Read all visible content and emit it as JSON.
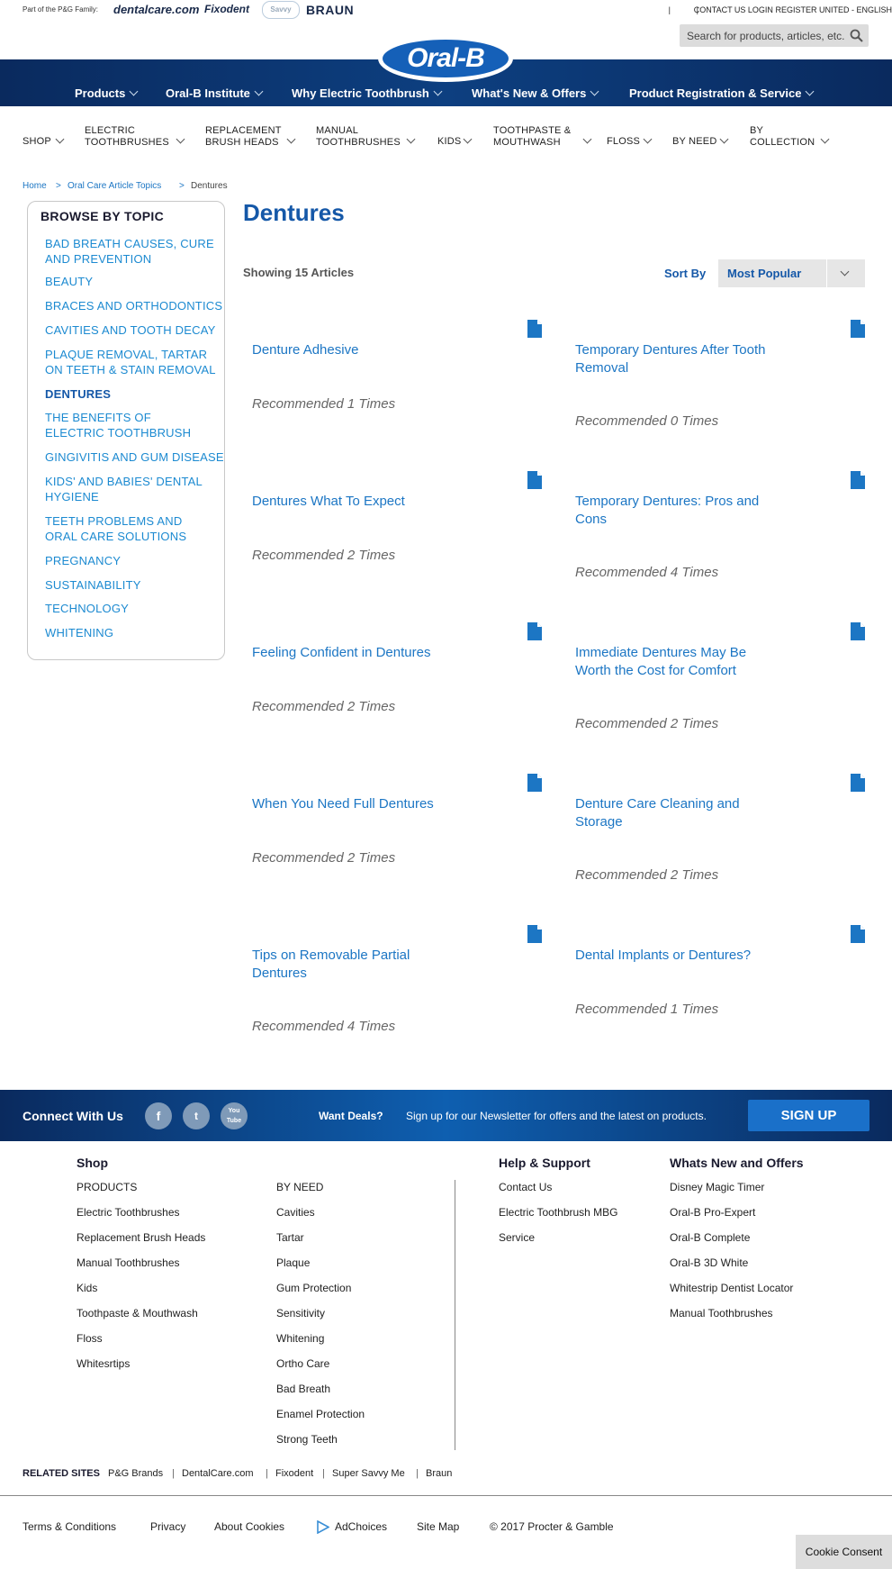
{
  "topbar": {
    "family_text": "Part of the P&G Family:",
    "brands": [
      "dentalcare.com",
      "Fixodent",
      "Savvy",
      "BRAUN"
    ],
    "links": [
      "CONTACT US",
      "|",
      "LOGIN",
      "|",
      "REGISTER"
    ],
    "locale": "UNITED - ENGLISH",
    "search_placeholder": "Search for products, articles, etc."
  },
  "logo": "Oral-B",
  "main_nav": [
    "Products",
    "Oral-B Institute",
    "Why Electric Toothbrush",
    "What's New & Offers",
    "Product Registration & Service"
  ],
  "category_nav": [
    [
      "SHOP"
    ],
    [
      "ELECTRIC",
      "TOOTHBRUSHES"
    ],
    [
      "REPLACEMENT",
      "BRUSH HEADS"
    ],
    [
      "MANUAL",
      "TOOTHBRUSHES"
    ],
    [
      "KIDS"
    ],
    [
      "TOOTHPASTE &",
      "MOUTHWASH"
    ],
    [
      "FLOSS"
    ],
    [
      "BY NEED"
    ],
    [
      "BY",
      "COLLECTION"
    ]
  ],
  "breadcrumb": [
    "Home",
    ">",
    "Oral Care Article Topics",
    ">",
    "Dentures"
  ],
  "sidebar": {
    "title": "BROWSE BY TOPIC",
    "items": [
      "BAD BREATH CAUSES, CURE AND PREVENTION",
      "BEAUTY",
      "BRACES AND ORTHODONTICS",
      "CAVITIES AND TOOTH DECAY",
      "PLAQUE REMOVAL, TARTAR ON TEETH & STAIN REMOVAL",
      "DENTURES",
      "THE BENEFITS OF ELECTRIC TOOTHBRUSH",
      "GINGIVITIS AND GUM DISEASE",
      "KIDS' AND BABIES' DENTAL HYGIENE",
      "TEETH PROBLEMS AND ORAL CARE SOLUTIONS",
      "PREGNANCY",
      "SUSTAINABILITY",
      "TECHNOLOGY",
      "WHITENING"
    ]
  },
  "main": {
    "title": "Dentures",
    "showing": "Showing 15 Articles",
    "sort_label": "Sort By",
    "sort_value": "Most Popular",
    "articles": [
      {
        "title": "Denture Adhesive",
        "rec": "Recommended 1 Times"
      },
      {
        "title": "Temporary Dentures After Tooth Removal",
        "rec": "Recommended 0 Times"
      },
      {
        "title": "Dentures What To Expect",
        "rec": "Recommended 2 Times"
      },
      {
        "title": "Temporary Dentures: Pros and Cons",
        "rec": "Recommended 4 Times"
      },
      {
        "title": "Feeling Confident in Dentures",
        "rec": "Recommended 2 Times"
      },
      {
        "title": "Immediate Dentures May Be Worth the Cost for Comfort",
        "rec": "Recommended 2 Times"
      },
      {
        "title": "When You Need Full Dentures",
        "rec": "Recommended 2 Times"
      },
      {
        "title": "Denture Care Cleaning and Storage",
        "rec": "Recommended 2 Times"
      },
      {
        "title": "Tips on Removable Partial Dentures",
        "rec": "Recommended 4 Times"
      },
      {
        "title": "Dental Implants or Dentures?",
        "rec": "Recommended 1 Times"
      }
    ]
  },
  "connect": {
    "label": "Connect With Us",
    "social": [
      "f",
      "t",
      "You Tube"
    ],
    "deals": "Want Deals?",
    "newsletter": "Sign up for our Newsletter for offers and the latest on products.",
    "signup": "SIGN UP"
  },
  "footer": {
    "shop_head": "Shop",
    "shop_col1": [
      "PRODUCTS",
      "Electric Toothbrushes",
      "Replacement Brush Heads",
      "Manual Toothbrushes",
      "Kids",
      "Toothpaste & Mouthwash",
      "Floss",
      "Whitesrtips"
    ],
    "shop_col2": [
      "BY NEED",
      "Cavities",
      "Tartar",
      "Plaque",
      "Gum Protection",
      "Sensitivity",
      "Whitening",
      "Ortho Care",
      "Bad Breath",
      "Enamel Protection",
      "Strong Teeth"
    ],
    "help_head": "Help & Support",
    "help_links": [
      "Contact Us",
      "Electric Toothbrush MBG",
      "Service"
    ],
    "new_head": "Whats New and Offers",
    "new_links": [
      "Disney Magic Timer",
      "Oral-B Pro-Expert",
      "Oral-B Complete",
      "Oral-B 3D White",
      "Whitestrip Dentist Locator",
      "Manual Toothbrushes"
    ],
    "related_label": "RELATED SITES",
    "related_links": [
      "P&G Brands",
      "DentalCare.com",
      "Fixodent",
      "Super Savvy Me",
      "Braun"
    ],
    "bottom_links": [
      "Terms & Conditions",
      "Privacy",
      "About Cookies",
      "AdChoices",
      "Site Map",
      "© 2017 Procter & Gamble"
    ],
    "cookie": "Cookie Consent"
  }
}
